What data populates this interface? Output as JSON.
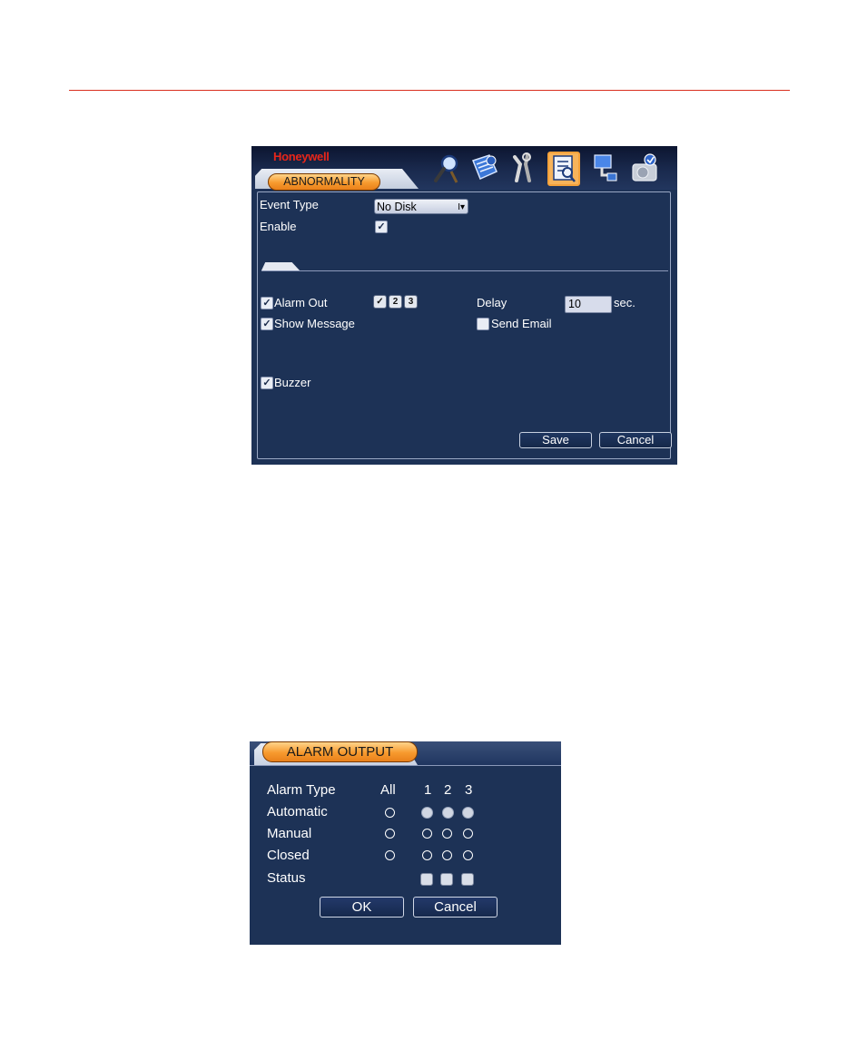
{
  "abnormality": {
    "brand": "Honeywell",
    "tab_title": "ABNORMALITY",
    "toolbar_icons": [
      "search-icon",
      "info-book-icon",
      "tools-icon",
      "event-config-icon",
      "network-icon",
      "hdd-icon"
    ],
    "event_type_label": "Event Type",
    "event_type_value": "No Disk",
    "enable_label": "Enable",
    "enable_checked": true,
    "alarm_out_label": "Alarm Out",
    "alarm_out_checked": true,
    "alarm_channels": [
      "1",
      "2",
      "3"
    ],
    "alarm_channel_selected": [
      "1"
    ],
    "delay_label": "Delay",
    "delay_value": "10",
    "delay_unit": "sec.",
    "show_message_label": "Show Message",
    "show_message_checked": true,
    "send_email_label": "Send Email",
    "send_email_checked": false,
    "buzzer_label": "Buzzer",
    "buzzer_checked": true,
    "save_label": "Save",
    "cancel_label": "Cancel",
    "accent_color": "#f79a2e",
    "brand_color": "#e8261a"
  },
  "alarm_output": {
    "tab_title": "ALARM OUTPUT",
    "header_label": "Alarm Type",
    "all_label": "All",
    "channels": [
      "1",
      "2",
      "3"
    ],
    "rows": [
      {
        "label": "Automatic",
        "all": false,
        "channels": [
          true,
          true,
          true
        ]
      },
      {
        "label": "Manual",
        "all": false,
        "channels": [
          false,
          false,
          false
        ]
      },
      {
        "label": "Closed",
        "all": false,
        "channels": [
          false,
          false,
          false
        ]
      }
    ],
    "status_label": "Status",
    "ok_label": "OK",
    "cancel_label": "Cancel"
  }
}
